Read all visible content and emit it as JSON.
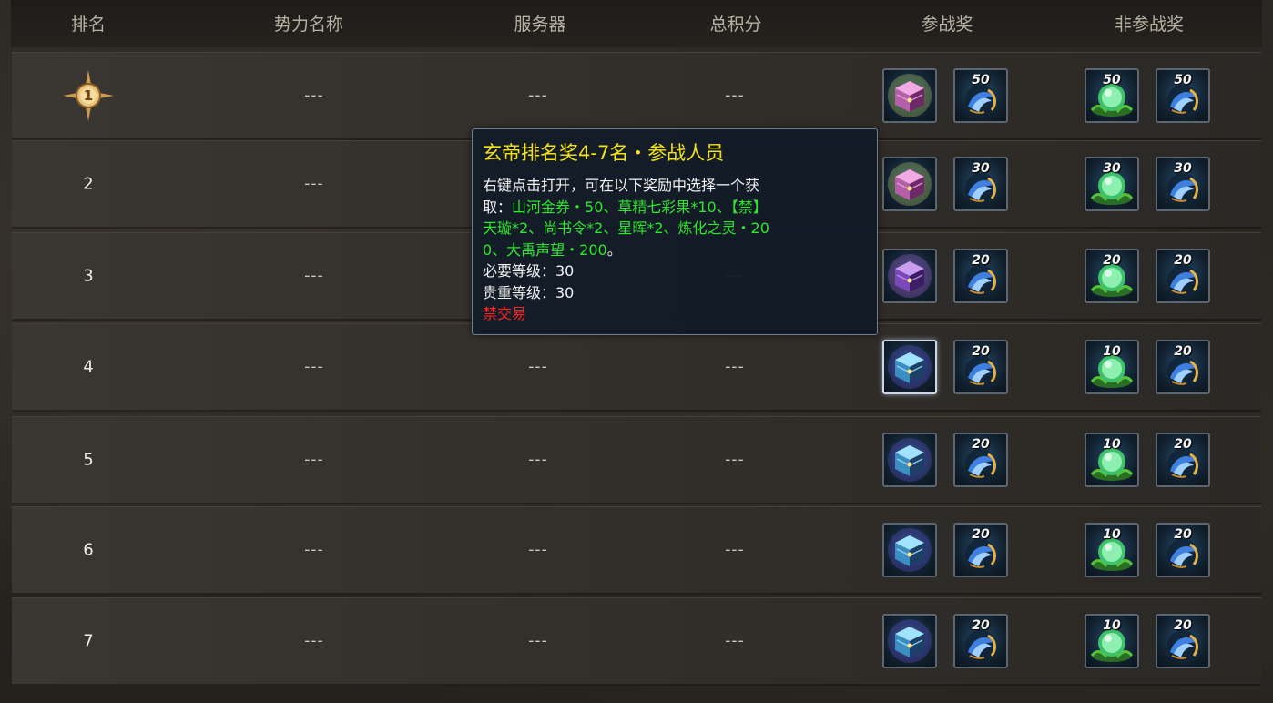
{
  "header": {
    "rank": "排名",
    "faction": "势力名称",
    "server": "服务器",
    "score": "总积分",
    "participant_reward": "参战奖",
    "non_participant_reward": "非参战奖"
  },
  "colors": {
    "tooltip_title": "#f4e21a",
    "tooltip_green": "#2fe62f",
    "tooltip_red": "#ff2323"
  },
  "rows": [
    {
      "rank": "1",
      "rank_icon": "rank-1-medal-icon",
      "faction": "---",
      "server": "---",
      "score": "---",
      "p_item": "pink-chest-icon",
      "p_qty": "50",
      "n_qty1": "50",
      "n_qty2": "50"
    },
    {
      "rank": "2",
      "faction": "---",
      "server": "---",
      "score": "---",
      "p_item": "pink-chest-icon",
      "p_qty": "30",
      "n_qty1": "30",
      "n_qty2": "30"
    },
    {
      "rank": "3",
      "faction": "---",
      "server": "---",
      "score": "---",
      "p_item": "purple-chest-icon",
      "p_qty": "20",
      "n_qty1": "20",
      "n_qty2": "20"
    },
    {
      "rank": "4",
      "faction": "---",
      "server": "---",
      "score": "---",
      "p_item": "blue-chest-icon",
      "p_qty": "20",
      "n_qty1": "10",
      "n_qty2": "20"
    },
    {
      "rank": "5",
      "faction": "---",
      "server": "---",
      "score": "---",
      "p_item": "blue-chest-icon",
      "p_qty": "20",
      "n_qty1": "10",
      "n_qty2": "20"
    },
    {
      "rank": "6",
      "faction": "---",
      "server": "---",
      "score": "---",
      "p_item": "blue-chest-icon",
      "p_qty": "20",
      "n_qty1": "10",
      "n_qty2": "20"
    },
    {
      "rank": "7",
      "faction": "---",
      "server": "---",
      "score": "---",
      "p_item": "blue-chest-icon",
      "p_qty": "20",
      "n_qty1": "10",
      "n_qty2": "20"
    }
  ],
  "tooltip": {
    "title": "玄帝排名奖4-7名・参战人员",
    "line1": "右键点击打开，可在以下奖励中选择一个获",
    "line2_prefix": "取：",
    "line2_green": "山河金券・50、草精七彩果*10、【禁】",
    "line3_green": "天璇*2、尚书令*2、星晖*2、炼化之灵・20",
    "line4_green": "0、大禹声望・200",
    "line4_suffix": "。",
    "req_level": "必要等级：30",
    "noble_level": "贵重等级：30",
    "no_trade": "禁交易"
  }
}
